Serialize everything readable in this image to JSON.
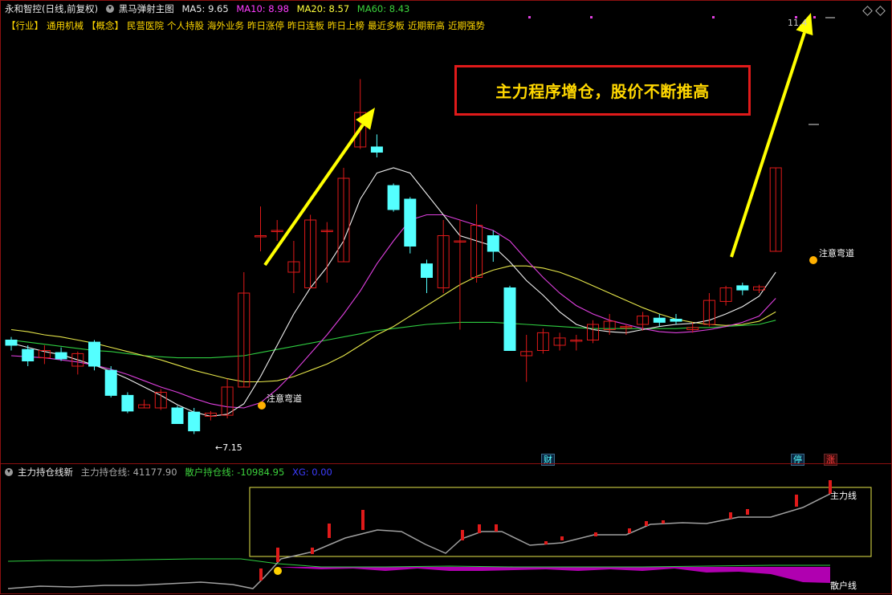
{
  "stock": {
    "name": "永和智控(日线,前复权)",
    "indicator": "黑马弹射主图",
    "ma": [
      {
        "label": "MA5: 9.65",
        "color": "#e8e8e8"
      },
      {
        "label": "MA10: 8.98",
        "color": "#ff3cff"
      },
      {
        "label": "MA20: 8.57",
        "color": "#ffff3c"
      },
      {
        "label": "MA60: 8.43",
        "color": "#3cd23c"
      }
    ]
  },
  "concepts": [
    "【行业】",
    "通用机械",
    "【概念】",
    "民营医院",
    "个人持股",
    "海外业务",
    "昨日涨停",
    "昨日连板",
    "昨日上榜",
    "最近多板",
    "近期新高",
    "近期强势"
  ],
  "callout": "主力程序增仓，股价不断推高",
  "labels": {
    "low_price": "7.15",
    "high_price": "11.4",
    "attention1": "注意弯道",
    "attention2": "注意弯道",
    "badge_cai": "财",
    "badge_ting": "停",
    "badge_zhang": "涨"
  },
  "sub": {
    "title": "主力持仓线新",
    "line1": "主力持仓线: 41177.90",
    "line2": "散户持仓线: -10984.95",
    "line3": "XG: 0.00",
    "main_label": "主力线",
    "retail_label": "散户线"
  },
  "colors": {
    "up": "#e01a1a",
    "down": "#54ffff",
    "accent": "#ffd700"
  },
  "chart_data": {
    "type": "candlestick",
    "candles": [
      {
        "o": 7.95,
        "c": 7.9,
        "h": 7.98,
        "l": 7.85
      },
      {
        "o": 7.86,
        "c": 7.75,
        "h": 7.9,
        "l": 7.7
      },
      {
        "o": 7.78,
        "c": 7.85,
        "h": 7.9,
        "l": 7.72
      },
      {
        "o": 7.83,
        "c": 7.77,
        "h": 7.88,
        "l": 7.75
      },
      {
        "o": 7.7,
        "c": 7.82,
        "h": 7.84,
        "l": 7.62
      },
      {
        "o": 7.93,
        "c": 7.7,
        "h": 7.95,
        "l": 7.66
      },
      {
        "o": 7.66,
        "c": 7.42,
        "h": 7.7,
        "l": 7.4
      },
      {
        "o": 7.42,
        "c": 7.27,
        "h": 7.45,
        "l": 7.25
      },
      {
        "o": 7.3,
        "c": 7.33,
        "h": 7.38,
        "l": 7.3
      },
      {
        "o": 7.3,
        "c": 7.45,
        "h": 7.48,
        "l": 7.28
      },
      {
        "o": 7.3,
        "c": 7.15,
        "h": 7.32,
        "l": 7.15
      },
      {
        "o": 7.26,
        "c": 7.08,
        "h": 7.3,
        "l": 7.05
      },
      {
        "o": 7.22,
        "c": 7.25,
        "h": 7.27,
        "l": 7.18
      },
      {
        "o": 7.23,
        "c": 7.5,
        "h": 7.58,
        "l": 7.2
      },
      {
        "o": 7.5,
        "c": 8.4,
        "h": 8.6,
        "l": 7.5
      },
      {
        "o": 8.95,
        "c": 8.95,
        "h": 9.23,
        "l": 8.8
      },
      {
        "o": 9.0,
        "c": 9.0,
        "h": 9.1,
        "l": 8.9
      },
      {
        "o": 8.6,
        "c": 8.7,
        "h": 8.9,
        "l": 8.4
      },
      {
        "o": 8.45,
        "c": 9.1,
        "h": 9.15,
        "l": 8.45
      },
      {
        "o": 9.0,
        "c": 9.0,
        "h": 9.08,
        "l": 8.5
      },
      {
        "o": 8.7,
        "c": 9.5,
        "h": 9.6,
        "l": 8.7
      },
      {
        "o": 9.8,
        "c": 10.13,
        "h": 10.45,
        "l": 9.78
      },
      {
        "o": 9.8,
        "c": 9.75,
        "h": 9.92,
        "l": 9.7
      },
      {
        "o": 9.43,
        "c": 9.2,
        "h": 9.45,
        "l": 9.18
      },
      {
        "o": 9.3,
        "c": 8.85,
        "h": 9.32,
        "l": 8.78
      },
      {
        "o": 8.68,
        "c": 8.55,
        "h": 8.72,
        "l": 8.4
      },
      {
        "o": 8.45,
        "c": 8.95,
        "h": 9.1,
        "l": 8.4
      },
      {
        "o": 8.9,
        "c": 8.9,
        "h": 9.1,
        "l": 8.05
      },
      {
        "o": 8.55,
        "c": 9.05,
        "h": 9.25,
        "l": 8.5
      },
      {
        "o": 8.95,
        "c": 8.8,
        "h": 9.0,
        "l": 8.7
      },
      {
        "o": 8.45,
        "c": 7.85,
        "h": 8.47,
        "l": 7.85
      },
      {
        "o": 7.8,
        "c": 7.84,
        "h": 8.0,
        "l": 7.55
      },
      {
        "o": 7.85,
        "c": 8.02,
        "h": 8.06,
        "l": 7.82
      },
      {
        "o": 7.9,
        "c": 7.97,
        "h": 8.02,
        "l": 7.85
      },
      {
        "o": 7.95,
        "c": 7.95,
        "h": 8.0,
        "l": 7.85
      },
      {
        "o": 7.95,
        "c": 8.1,
        "h": 8.14,
        "l": 7.92
      },
      {
        "o": 8.05,
        "c": 8.13,
        "h": 8.2,
        "l": 8.0
      },
      {
        "o": 8.07,
        "c": 8.08,
        "h": 8.1,
        "l": 8.0
      },
      {
        "o": 8.1,
        "c": 8.18,
        "h": 8.22,
        "l": 8.04
      },
      {
        "o": 8.16,
        "c": 8.12,
        "h": 8.2,
        "l": 8.08
      },
      {
        "o": 8.15,
        "c": 8.13,
        "h": 8.2,
        "l": 8.1
      },
      {
        "o": 8.05,
        "c": 8.07,
        "h": 8.12,
        "l": 8.02
      },
      {
        "o": 8.1,
        "c": 8.33,
        "h": 8.4,
        "l": 8.08
      },
      {
        "o": 8.32,
        "c": 8.45,
        "h": 8.47,
        "l": 8.28
      },
      {
        "o": 8.47,
        "c": 8.43,
        "h": 8.5,
        "l": 8.38
      },
      {
        "o": 8.43,
        "c": 8.46,
        "h": 8.48,
        "l": 8.4
      },
      {
        "o": 8.8,
        "c": 9.6,
        "h": 9.6,
        "l": 8.8
      }
    ],
    "ma5": [
      7.92,
      7.88,
      7.84,
      7.81,
      7.76,
      7.71,
      7.65,
      7.58,
      7.5,
      7.42,
      7.33,
      7.26,
      7.22,
      7.24,
      7.34,
      7.6,
      7.9,
      8.2,
      8.45,
      8.65,
      8.9,
      9.3,
      9.55,
      9.6,
      9.55,
      9.35,
      9.15,
      8.95,
      8.9,
      8.85,
      8.7,
      8.52,
      8.38,
      8.22,
      8.1,
      8.05,
      8.03,
      8.02,
      8.05,
      8.08,
      8.1,
      8.11,
      8.14,
      8.2,
      8.27,
      8.37,
      8.6
    ],
    "ma10": [
      7.8,
      7.79,
      7.78,
      7.76,
      7.74,
      7.71,
      7.67,
      7.62,
      7.56,
      7.5,
      7.45,
      7.39,
      7.34,
      7.31,
      7.3,
      7.35,
      7.48,
      7.64,
      7.82,
      8.0,
      8.2,
      8.42,
      8.68,
      8.9,
      9.1,
      9.15,
      9.15,
      9.1,
      9.05,
      9.0,
      8.9,
      8.72,
      8.55,
      8.4,
      8.28,
      8.2,
      8.14,
      8.1,
      8.06,
      8.03,
      8.02,
      8.03,
      8.05,
      8.08,
      8.12,
      8.18,
      8.35
    ],
    "ma20": [
      8.05,
      8.03,
      8.0,
      7.98,
      7.95,
      7.92,
      7.88,
      7.84,
      7.8,
      7.76,
      7.71,
      7.66,
      7.62,
      7.58,
      7.55,
      7.55,
      7.56,
      7.6,
      7.66,
      7.72,
      7.8,
      7.9,
      8.0,
      8.08,
      8.18,
      8.28,
      8.38,
      8.48,
      8.56,
      8.62,
      8.66,
      8.66,
      8.64,
      8.6,
      8.54,
      8.47,
      8.4,
      8.33,
      8.26,
      8.2,
      8.15,
      8.12,
      8.1,
      8.09,
      8.1,
      8.13,
      8.22
    ],
    "ma60": [
      7.95,
      7.93,
      7.91,
      7.89,
      7.87,
      7.85,
      7.84,
      7.82,
      7.8,
      7.79,
      7.78,
      7.78,
      7.78,
      7.79,
      7.8,
      7.83,
      7.86,
      7.89,
      7.92,
      7.95,
      7.98,
      8.01,
      8.04,
      8.06,
      8.08,
      8.1,
      8.11,
      8.12,
      8.12,
      8.12,
      8.11,
      8.1,
      8.09,
      8.08,
      8.07,
      8.06,
      8.06,
      8.06,
      8.06,
      8.06,
      8.06,
      8.07,
      8.07,
      8.08,
      8.09,
      8.1,
      8.14
    ],
    "ylim": [
      6.9,
      10.9
    ]
  }
}
